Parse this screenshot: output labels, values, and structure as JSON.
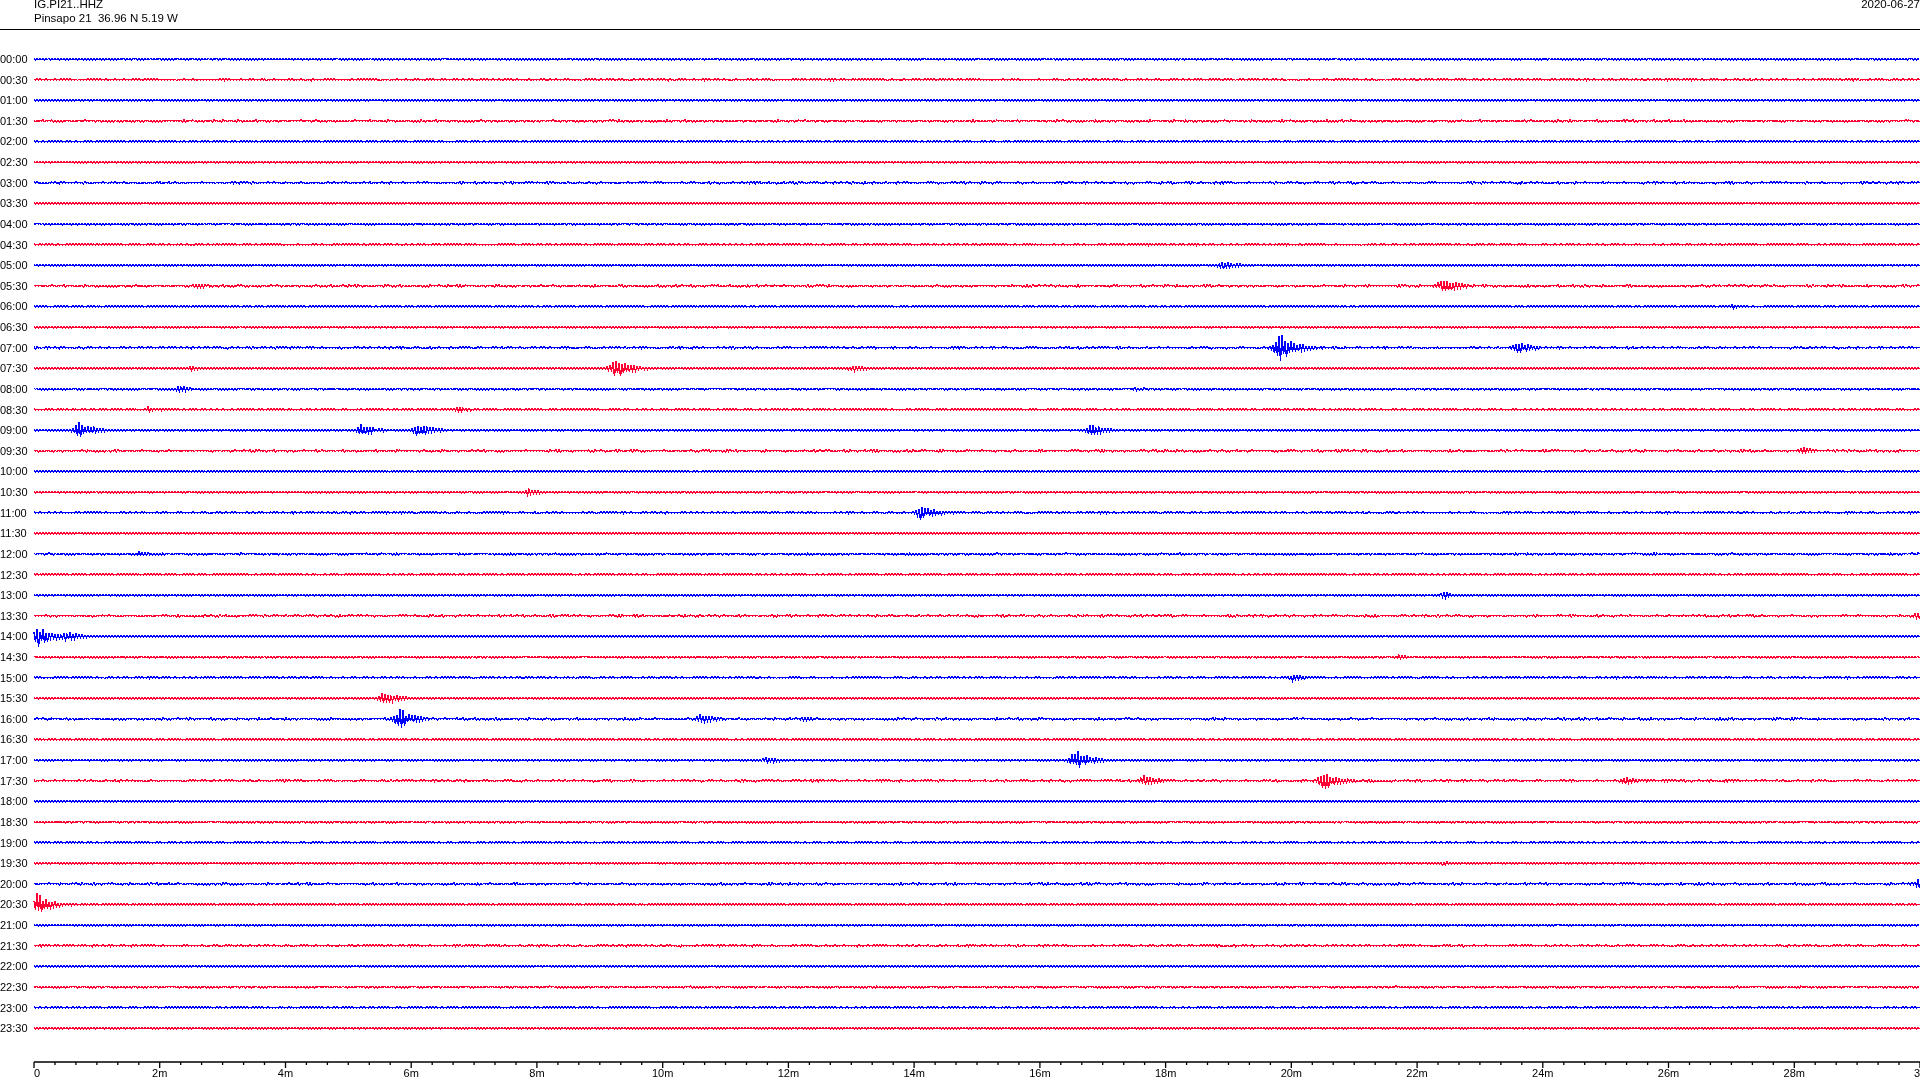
{
  "header": {
    "station_code": "IG.PI21..HHZ",
    "station_location": "Pinsapo 21  36.96 N 5.19 W",
    "date": "2020-06-27"
  },
  "rows": [
    {
      "time": "00:00",
      "color": "#0000ff"
    },
    {
      "time": "00:30",
      "color": "#ff0033"
    },
    {
      "time": "01:00",
      "color": "#0000ff"
    },
    {
      "time": "01:30",
      "color": "#ff0033"
    },
    {
      "time": "02:00",
      "color": "#0000ff"
    },
    {
      "time": "02:30",
      "color": "#ff0033"
    },
    {
      "time": "03:00",
      "color": "#0000ff"
    },
    {
      "time": "03:30",
      "color": "#ff0033"
    },
    {
      "time": "04:00",
      "color": "#0000ff"
    },
    {
      "time": "04:30",
      "color": "#ff0033"
    },
    {
      "time": "05:00",
      "color": "#0000ff"
    },
    {
      "time": "05:30",
      "color": "#ff0033"
    },
    {
      "time": "06:00",
      "color": "#0000ff"
    },
    {
      "time": "06:30",
      "color": "#ff0033"
    },
    {
      "time": "07:00",
      "color": "#0000ff"
    },
    {
      "time": "07:30",
      "color": "#ff0033"
    },
    {
      "time": "08:00",
      "color": "#0000ff"
    },
    {
      "time": "08:30",
      "color": "#ff0033"
    },
    {
      "time": "09:00",
      "color": "#0000ff"
    },
    {
      "time": "09:30",
      "color": "#ff0033"
    },
    {
      "time": "10:00",
      "color": "#0000ff"
    },
    {
      "time": "10:30",
      "color": "#ff0033"
    },
    {
      "time": "11:00",
      "color": "#0000ff"
    },
    {
      "time": "11:30",
      "color": "#ff0033"
    },
    {
      "time": "12:00",
      "color": "#0000ff"
    },
    {
      "time": "12:30",
      "color": "#ff0033"
    },
    {
      "time": "13:00",
      "color": "#0000ff"
    },
    {
      "time": "13:30",
      "color": "#ff0033"
    },
    {
      "time": "14:00",
      "color": "#0000ff"
    },
    {
      "time": "14:30",
      "color": "#ff0033"
    },
    {
      "time": "15:00",
      "color": "#0000ff"
    },
    {
      "time": "15:30",
      "color": "#ff0033"
    },
    {
      "time": "16:00",
      "color": "#0000ff"
    },
    {
      "time": "16:30",
      "color": "#ff0033"
    },
    {
      "time": "17:00",
      "color": "#0000ff"
    },
    {
      "time": "17:30",
      "color": "#ff0033"
    },
    {
      "time": "18:00",
      "color": "#0000ff"
    },
    {
      "time": "18:30",
      "color": "#ff0033"
    },
    {
      "time": "19:00",
      "color": "#0000ff"
    },
    {
      "time": "19:30",
      "color": "#ff0033"
    },
    {
      "time": "20:00",
      "color": "#0000ff"
    },
    {
      "time": "20:30",
      "color": "#ff0033"
    },
    {
      "time": "21:00",
      "color": "#0000ff"
    },
    {
      "time": "21:30",
      "color": "#ff0033"
    },
    {
      "time": "22:00",
      "color": "#0000ff"
    },
    {
      "time": "22:30",
      "color": "#ff0033"
    },
    {
      "time": "23:00",
      "color": "#0000ff"
    },
    {
      "time": "23:30",
      "color": "#ff0033"
    }
  ],
  "x_axis": {
    "tick_labels": [
      "0",
      "2m",
      "4m",
      "6m",
      "8m",
      "10m",
      "12m",
      "14m",
      "16m",
      "18m",
      "20m",
      "22m",
      "24m",
      "26m",
      "28m",
      "3"
    ]
  }
}
